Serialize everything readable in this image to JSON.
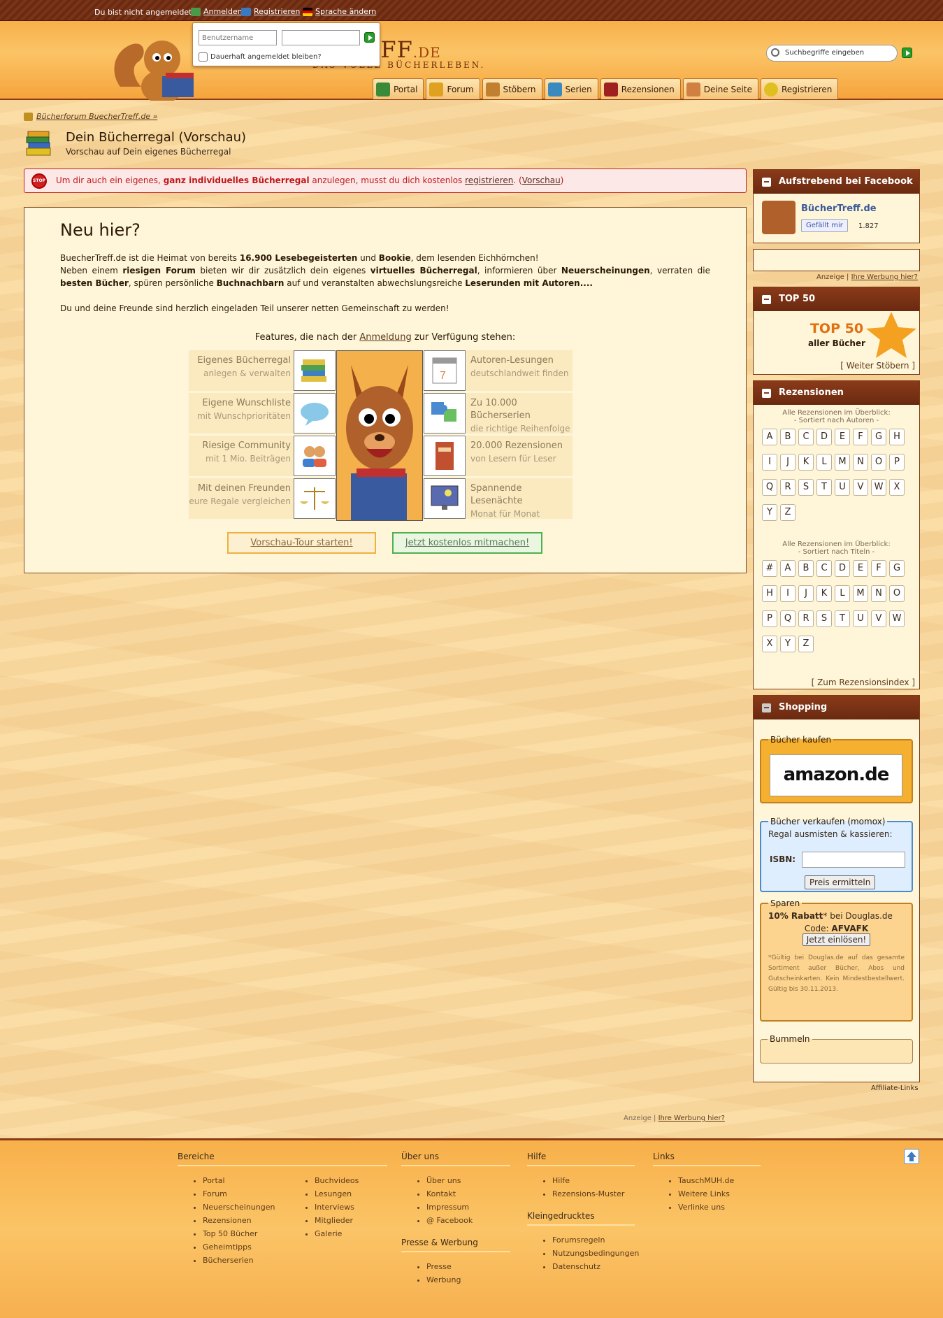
{
  "topbar": {
    "not_logged_in": "Du bist nicht angemeldet.",
    "login": "Anmelden",
    "register": "Registrieren",
    "language": "Sprache ändern"
  },
  "login_box": {
    "username_placeholder": "Benutzername",
    "remember": "Dauerhaft angemeldet bleiben?"
  },
  "logo": {
    "main": "EFF",
    "tld": ".DE",
    "tagline": "DAS VOLLE BÜCHERLEBEN."
  },
  "search": {
    "placeholder": "Suchbegriffe eingeben"
  },
  "nav": [
    "Portal",
    "Forum",
    "Stöbern",
    "Serien",
    "Rezensionen",
    "Deine Seite",
    "Registrieren"
  ],
  "breadcrumb": "Bücherforum BuecherTreff.de »",
  "page": {
    "title": "Dein Bücherregal (Vorschau)",
    "subtitle": "Vorschau auf Dein eigenes Bücherregal"
  },
  "alert": {
    "pre": "Um dir auch ein eigenes, ",
    "bold": "ganz individuelles Bücherregal",
    "mid": " anzulegen, musst du dich kostenlos ",
    "register": "registrieren",
    "dot": ". (",
    "preview": "Vorschau",
    "end": ")"
  },
  "intro": {
    "heading": "Neu hier?",
    "p1_a": "BuecherTreff.de ist die Heimat von bereits ",
    "p1_b": "16.900 Lesebegeisterten",
    "p1_c": " und ",
    "p1_d": "Bookie",
    "p1_e": ", dem lesenden Eichhörnchen!",
    "p2_a": "Neben einem ",
    "p2_b": "riesigen Forum",
    "p2_c": " bieten wir dir zusätzlich dein eigenes ",
    "p2_d": "virtuelles Bücherregal",
    "p2_e": ", informieren über ",
    "p2_f": "Neuerscheinungen",
    "p2_g": ", verraten die ",
    "p2_h": "besten Bücher",
    "p2_i": ", spüren persönliche ",
    "p2_j": "Buchnachbarn",
    "p2_k": " auf und veranstalten abwechslungsreiche ",
    "p2_l": "Leserunden mit Autoren....",
    "p3": "Du und deine Freunde sind herzlich eingeladen Teil unserer netten Gemeinschaft zu werden!",
    "features_pre": "Features, die nach der ",
    "features_link": "Anmeldung",
    "features_post": " zur Verfügung stehen:"
  },
  "features_left": [
    {
      "t1": "Eigenes Bücherregal",
      "t2": "anlegen & verwalten"
    },
    {
      "t1": "Eigene Wunschliste",
      "t2": "mit Wunschprioritäten"
    },
    {
      "t1": "Riesige Community",
      "t2": "mit 1 Mio. Beiträgen"
    },
    {
      "t1": "Mit deinen Freunden",
      "t2": "eure Regale vergleichen"
    }
  ],
  "features_right": [
    {
      "t1": "Autoren-Lesungen",
      "t2": "deutschlandweit finden"
    },
    {
      "t1": "Zu 10.000 Bücherserien",
      "t2": "die richtige Reihenfolge"
    },
    {
      "t1": "20.000 Rezensionen",
      "t2": "von Lesern für Leser"
    },
    {
      "t1": "Spannende Lesenächte",
      "t2": "Monat für Monat"
    }
  ],
  "buttons": {
    "tour": "Vorschau-Tour starten!",
    "join": "Jetzt kostenlos mitmachen!"
  },
  "sidebar": {
    "facebook": {
      "title": "Aufstrebend bei Facebook :)",
      "name": "BücherTreff.de",
      "like": "Gefällt mir",
      "count": "1.827"
    },
    "ad": {
      "label": "Anzeige",
      "link": "Ihre Werbung hier?"
    },
    "top50": {
      "title": "TOP 50",
      "big": "TOP 50",
      "small": "aller Bücher",
      "more": "[ Weiter Stöbern ]"
    },
    "reviews": {
      "title": "Rezensionen",
      "by_author_1": "Alle Rezensionen im Überblick:",
      "by_author_2": "- Sortiert nach Autoren -",
      "authors": [
        "A",
        "B",
        "C",
        "D",
        "E",
        "F",
        "G",
        "H",
        "I",
        "J",
        "K",
        "L",
        "M",
        "N",
        "O",
        "P",
        "Q",
        "R",
        "S",
        "T",
        "U",
        "V",
        "W",
        "X",
        "Y",
        "Z"
      ],
      "by_title_1": "Alle Rezensionen im Überblick:",
      "by_title_2": "- Sortiert nach Titeln -",
      "titles": [
        "#",
        "A",
        "B",
        "C",
        "D",
        "E",
        "F",
        "G",
        "H",
        "I",
        "J",
        "K",
        "L",
        "M",
        "N",
        "O",
        "P",
        "Q",
        "R",
        "S",
        "T",
        "U",
        "V",
        "W",
        "X",
        "Y",
        "Z"
      ],
      "index": "[ Zum Rezensionsindex ]"
    },
    "shopping": {
      "title": "Shopping",
      "buy_legend": "Bücher kaufen",
      "amazon": "amazon.de",
      "sell_legend": "Bücher verkaufen (momox)",
      "sell_text": "Regal ausmisten & kassieren:",
      "isbn": "ISBN:",
      "price_btn": "Preis ermitteln",
      "save_legend": "Sparen",
      "save_a": "10% Rabatt",
      "save_b": "* bei Douglas.de",
      "code_label": "Code: ",
      "code": "AFVAFK",
      "redeem": "Jetzt einlösen!",
      "fine": "*Gültig bei Douglas.de auf das gesamte Sortiment außer Bücher, Abos und Gutscheinkarten. Kein Mindestbestellwert. Gültig bis 30.11.2013.",
      "bummeln": "Bummeln"
    },
    "affiliate": "Affiliate-Links"
  },
  "bottom_ad": {
    "label": "Anzeige",
    "link": "Ihre Werbung hier?"
  },
  "footer": {
    "bereiche": {
      "title": "Bereiche",
      "col1": [
        "Portal",
        "Forum",
        "Neuerscheinungen",
        "Rezensionen",
        "Top 50 Bücher",
        "Geheimtipps",
        "Bücherserien"
      ],
      "col2": [
        "Buchvideos",
        "Lesungen",
        "Interviews",
        "Mitglieder",
        "Galerie"
      ]
    },
    "ueber": {
      "title": "Über uns",
      "items": [
        "Über uns",
        "Kontakt",
        "Impressum",
        "@ Facebook"
      ]
    },
    "presse": {
      "title": "Presse & Werbung",
      "items": [
        "Presse",
        "Werbung"
      ]
    },
    "hilfe": {
      "title": "Hilfe",
      "items": [
        "Hilfe",
        "Rezensions-Muster"
      ]
    },
    "klein": {
      "title": "Kleingedrucktes",
      "items": [
        "Forumsregeln",
        "Nutzungsbedingungen",
        "Datenschutz"
      ]
    },
    "links": {
      "title": "Links",
      "items": [
        "TauschMUH.de",
        "Weitere Links",
        "Verlinke uns"
      ]
    }
  }
}
